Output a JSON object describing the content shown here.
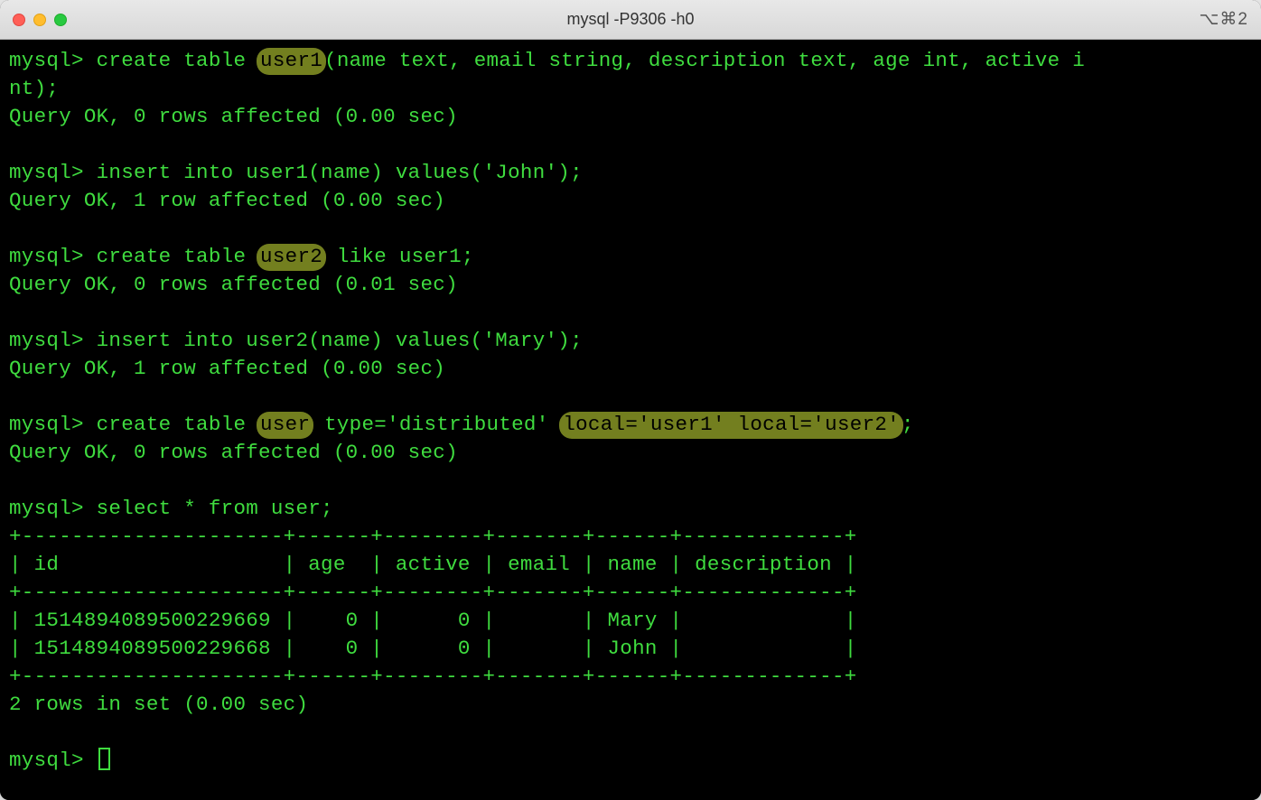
{
  "window": {
    "title": "mysql -P9306 -h0",
    "shortcut": "⌥⌘2"
  },
  "prompt": "mysql>",
  "lines": {
    "create_user1_pre": "mysql> create table ",
    "create_user1_hl": "user1",
    "create_user1_post": "(name text, email string, description text, age int, active i",
    "create_user1_cont": "nt);",
    "ok_0_rows_000": "Query OK, 0 rows affected (0.00 sec)",
    "insert_john": "mysql> insert into user1(name) values('John');",
    "ok_1_row_000": "Query OK, 1 row affected (0.00 sec)",
    "create_user2_pre": "mysql> create table ",
    "create_user2_hl": "user2",
    "create_user2_post": " like user1;",
    "ok_0_rows_001": "Query OK, 0 rows affected (0.01 sec)",
    "insert_mary": "mysql> insert into user2(name) values('Mary');",
    "create_user_pre": "mysql> create table ",
    "create_user_hl": "user",
    "create_user_mid": " type='distributed' ",
    "create_user_hl2": "local='user1' local='user2'",
    "create_user_post": ";",
    "select": "mysql> select * from user;",
    "table_border": "+---------------------+------+--------+-------+------+-------------+",
    "table_header": "| id                  | age  | active | email | name | description |",
    "table_row1": "| 1514894089500229669 |    0 |      0 |       | Mary |             |",
    "table_row2": "| 1514894089500229668 |    0 |      0 |       | John |             |",
    "result_summary": "2 rows in set (0.00 sec)",
    "final_prompt": "mysql> "
  }
}
